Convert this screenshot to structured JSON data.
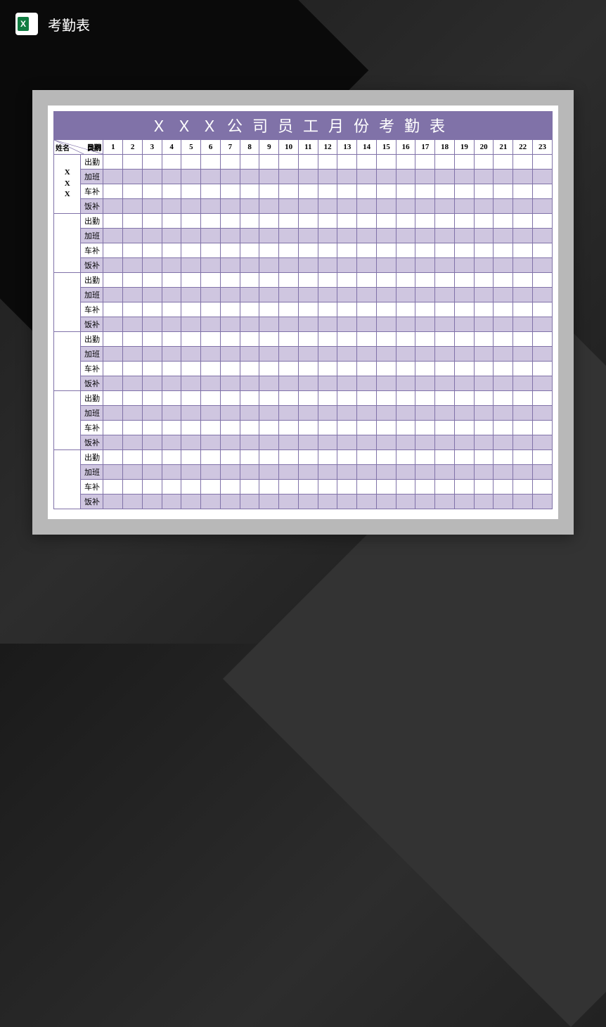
{
  "header": {
    "title": "考勤表"
  },
  "document": {
    "title": "ＸＸＸ公司员工月份考勤表",
    "corner": {
      "date": "日期",
      "name": "姓名",
      "type": "类别"
    },
    "dates": [
      "1",
      "2",
      "3",
      "4",
      "5",
      "6",
      "7",
      "8",
      "9",
      "10",
      "11",
      "12",
      "13",
      "14",
      "15",
      "16",
      "17",
      "18",
      "19",
      "20",
      "21",
      "22",
      "23"
    ],
    "employees": [
      {
        "name": "X\nX\nX",
        "categories": [
          "出勤",
          "加班",
          "车补",
          "饭补"
        ]
      },
      {
        "name": "",
        "categories": [
          "出勤",
          "加班",
          "车补",
          "饭补"
        ]
      },
      {
        "name": "",
        "categories": [
          "出勤",
          "加班",
          "车补",
          "饭补"
        ]
      },
      {
        "name": "",
        "categories": [
          "出勤",
          "加班",
          "车补",
          "饭补"
        ]
      },
      {
        "name": "",
        "categories": [
          "出勤",
          "加班",
          "车补",
          "饭补"
        ]
      },
      {
        "name": "",
        "categories": [
          "出勤",
          "加班",
          "车补",
          "饭补"
        ]
      }
    ]
  }
}
